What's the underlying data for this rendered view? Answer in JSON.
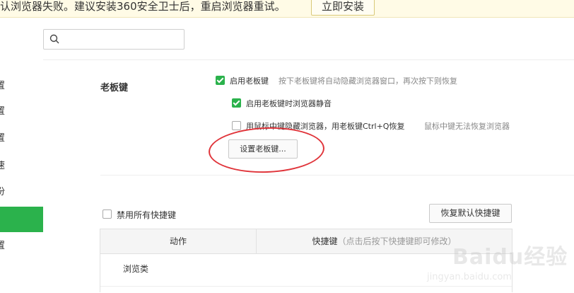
{
  "banner": {
    "message": "认浏览器失败。建议安装360安全卫士后，重启浏览器重试。",
    "install_button": "立即安装"
  },
  "search": {
    "placeholder": ""
  },
  "sidebar": {
    "items": [
      {
        "label": "置",
        "active": false
      },
      {
        "label": "置",
        "active": false
      },
      {
        "label": "置",
        "active": false
      },
      {
        "label": "速",
        "active": false
      },
      {
        "label": "份",
        "active": false
      },
      {
        "label": "",
        "active": true
      },
      {
        "label": "置",
        "active": false
      }
    ]
  },
  "boss_key": {
    "section_label": "老板键",
    "enable_label": "启用老板键",
    "enable_hint": "按下老板键将自动隐藏浏览器窗口，再次按下则恢复",
    "enable_checked": true,
    "mute_label": "启用老板键时浏览器静音",
    "mute_checked": true,
    "middle_click_label": "用鼠标中键隐藏浏览器，用老板键Ctrl+Q恢复",
    "middle_click_hint": "鼠标中键无法恢复浏览器",
    "middle_click_checked": false,
    "set_button": "设置老板键..."
  },
  "shortcuts": {
    "disable_all_label": "禁用所有快捷键",
    "disable_all_checked": false,
    "restore_button": "恢复默认快捷键",
    "table": {
      "col_action": "动作",
      "col_shortcut": "快捷键",
      "col_shortcut_hint": "（点击后按下快捷键即可修改）",
      "category": "浏览类"
    }
  },
  "watermark": {
    "logo": "Baidu经验",
    "url": "jingyan.baidu.com"
  },
  "colors": {
    "accent": "#2bb24c",
    "banner_bg": "#fffbe6",
    "annotation": "#e0343a"
  }
}
